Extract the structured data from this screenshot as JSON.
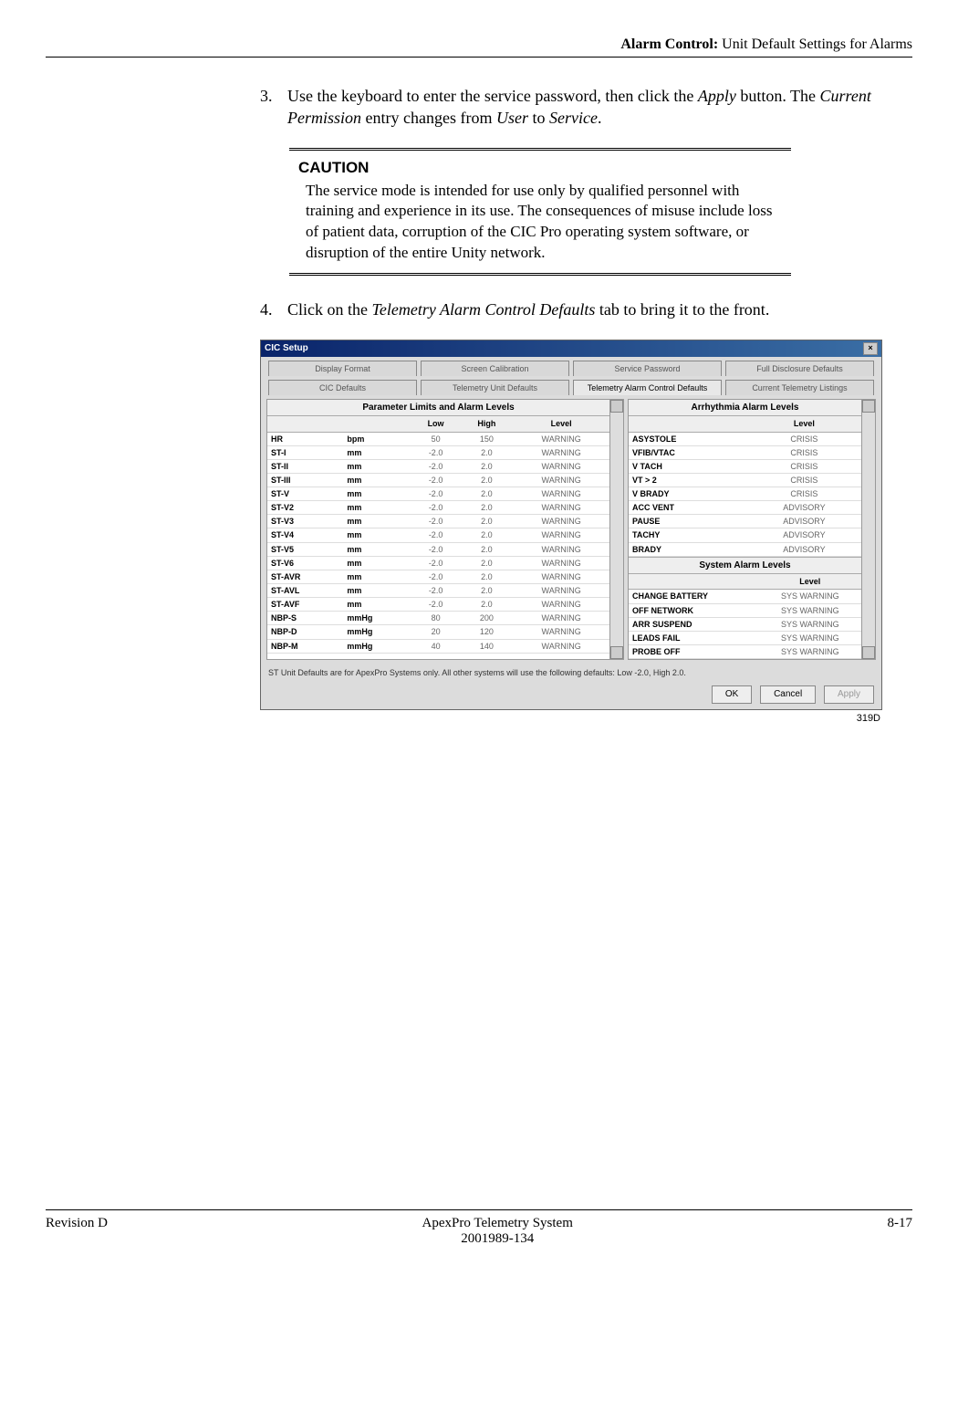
{
  "header": {
    "section": "Alarm Control:",
    "title": "Unit Default Settings for Alarms"
  },
  "steps": {
    "s3": {
      "num": "3.",
      "pre": "Use the keyboard to enter the service password, then click the ",
      "apply": "Apply",
      "mid": " button. The ",
      "cp": "Current Permission",
      "post1": " entry changes from ",
      "user": "User",
      "post2": " to ",
      "service": "Service",
      "end": "."
    },
    "s4": {
      "num": "4.",
      "pre": "Click on the ",
      "tab": "Telemetry Alarm Control Defaults",
      "post": " tab to bring it to the front."
    }
  },
  "caution": {
    "title": "CAUTION",
    "body": "The service mode is intended for use only by qualified personnel with training and experience in its use. The consequences of misuse include loss of patient data, corruption of the CIC Pro operating system software, or disruption of the entire Unity network."
  },
  "dialog": {
    "title": "CIC Setup",
    "tabs_row1": [
      "Display Format",
      "Screen Calibration",
      "Service Password",
      "Full Disclosure Defaults"
    ],
    "tabs_row2": [
      "CIC Defaults",
      "Telemetry Unit Defaults",
      "Telemetry Alarm Control Defaults",
      "Current Telemetry Listings"
    ],
    "active_tab_index": 2,
    "left": {
      "title": "Parameter Limits and Alarm Levels",
      "cols": [
        "",
        "",
        "Low",
        "High",
        "Level"
      ],
      "rows": [
        [
          "HR",
          "bpm",
          "50",
          "150",
          "WARNING"
        ],
        [
          "ST-I",
          "mm",
          "-2.0",
          "2.0",
          "WARNING"
        ],
        [
          "ST-II",
          "mm",
          "-2.0",
          "2.0",
          "WARNING"
        ],
        [
          "ST-III",
          "mm",
          "-2.0",
          "2.0",
          "WARNING"
        ],
        [
          "ST-V",
          "mm",
          "-2.0",
          "2.0",
          "WARNING"
        ],
        [
          "ST-V2",
          "mm",
          "-2.0",
          "2.0",
          "WARNING"
        ],
        [
          "ST-V3",
          "mm",
          "-2.0",
          "2.0",
          "WARNING"
        ],
        [
          "ST-V4",
          "mm",
          "-2.0",
          "2.0",
          "WARNING"
        ],
        [
          "ST-V5",
          "mm",
          "-2.0",
          "2.0",
          "WARNING"
        ],
        [
          "ST-V6",
          "mm",
          "-2.0",
          "2.0",
          "WARNING"
        ],
        [
          "ST-AVR",
          "mm",
          "-2.0",
          "2.0",
          "WARNING"
        ],
        [
          "ST-AVL",
          "mm",
          "-2.0",
          "2.0",
          "WARNING"
        ],
        [
          "ST-AVF",
          "mm",
          "-2.0",
          "2.0",
          "WARNING"
        ],
        [
          "NBP-S",
          "mmHg",
          "80",
          "200",
          "WARNING"
        ],
        [
          "NBP-D",
          "mmHg",
          "20",
          "120",
          "WARNING"
        ],
        [
          "NBP-M",
          "mmHg",
          "40",
          "140",
          "WARNING"
        ]
      ]
    },
    "right_arr": {
      "title": "Arrhythmia Alarm Levels",
      "col": "Level",
      "rows": [
        [
          "ASYSTOLE",
          "CRISIS"
        ],
        [
          "VFIB/VTAC",
          "CRISIS"
        ],
        [
          "V TACH",
          "CRISIS"
        ],
        [
          "VT > 2",
          "CRISIS"
        ],
        [
          "V BRADY",
          "CRISIS"
        ],
        [
          "ACC VENT",
          "ADVISORY"
        ],
        [
          "PAUSE",
          "ADVISORY"
        ],
        [
          "TACHY",
          "ADVISORY"
        ],
        [
          "BRADY",
          "ADVISORY"
        ]
      ]
    },
    "right_sys": {
      "title": "System Alarm Levels",
      "col": "Level",
      "rows": [
        [
          "CHANGE BATTERY",
          "SYS WARNING"
        ],
        [
          "OFF NETWORK",
          "SYS WARNING"
        ],
        [
          "ARR SUSPEND",
          "SYS WARNING"
        ],
        [
          "LEADS FAIL",
          "SYS WARNING"
        ],
        [
          "PROBE OFF",
          "SYS WARNING"
        ]
      ]
    },
    "footer_note": "ST Unit Defaults are for ApexPro Systems only. All other systems will use the following defaults: Low -2.0, High 2.0.",
    "buttons": {
      "ok": "OK",
      "cancel": "Cancel",
      "apply": "Apply"
    },
    "image_id": "319D"
  },
  "footer": {
    "left": "Revision D",
    "center1": "ApexPro Telemetry System",
    "center2": "2001989-134",
    "right": "8-17"
  }
}
